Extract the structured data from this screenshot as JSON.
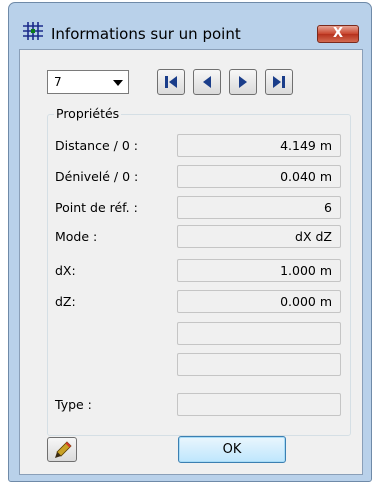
{
  "window": {
    "title": "Informations sur un point",
    "close_label": "X",
    "app_icon": "grid-icon"
  },
  "navigator": {
    "selected_point": "7",
    "buttons": [
      "first-icon",
      "previous-icon",
      "next-icon",
      "last-icon"
    ]
  },
  "properties": {
    "group_title": "Propriétés",
    "rows": [
      {
        "label": "Distance / 0 :",
        "value": "4.149 m"
      },
      {
        "label": "Dénivelé / 0 :",
        "value": "0.040 m"
      },
      {
        "label": "Point de réf. :",
        "value": "6"
      },
      {
        "label": "Mode :",
        "value": "dX dZ"
      },
      {
        "label": "dX:",
        "value": "1.000 m"
      },
      {
        "label": "dZ:",
        "value": "0.000 m"
      },
      {
        "label": "",
        "value": ""
      },
      {
        "label": "",
        "value": ""
      },
      {
        "label": "Type :",
        "value": ""
      }
    ]
  },
  "footer": {
    "edit_icon": "pencil-icon",
    "ok_label": "OK"
  },
  "colors": {
    "frame": "#b9d1ea",
    "client": "#f0f0f0",
    "close": "#c8442d",
    "nav_icon": "#1a3d8a"
  }
}
